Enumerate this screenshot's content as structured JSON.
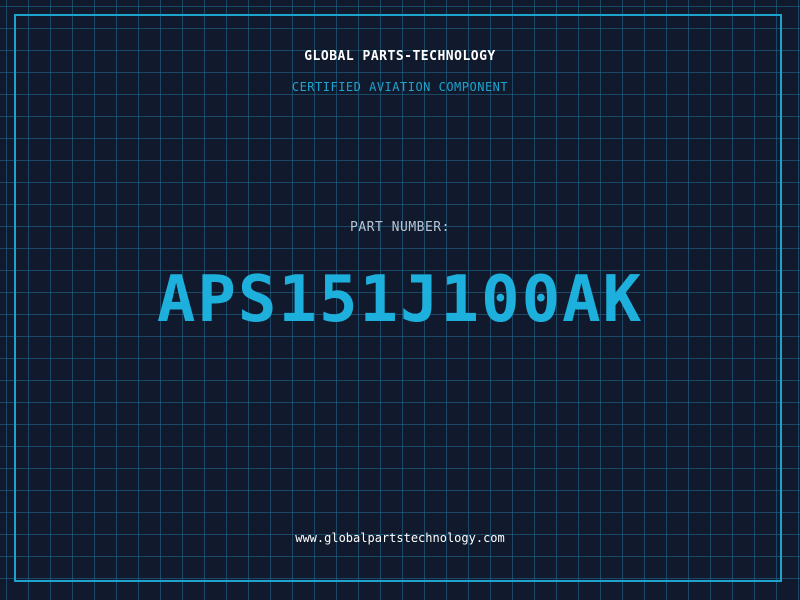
{
  "header": {
    "company": "GLOBAL PARTS-TECHNOLOGY",
    "subtitle": "CERTIFIED AVIATION COMPONENT"
  },
  "main": {
    "part_label": "PART NUMBER:",
    "part_number": "APS151J100AK"
  },
  "footer": {
    "website": "www.globalpartstechnology.com"
  },
  "colors": {
    "background": "#111a2c",
    "grid": "#236e96",
    "accent": "#1ea3cf",
    "part_number": "#1eb0dc",
    "text_light": "#ffffff",
    "label_gray": "#b7c4d3"
  }
}
